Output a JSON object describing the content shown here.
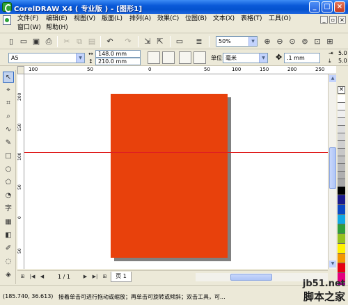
{
  "window": {
    "title": "CorelDRAW X4 ( 专业版 ) - [图形1]",
    "minimize": "_",
    "maximize": "□",
    "close": "×"
  },
  "menu": {
    "row1": [
      "文件(F)",
      "编辑(E)",
      "视图(V)",
      "版面(L)",
      "排列(A)",
      "效果(C)",
      "位图(B)",
      "文本(X)",
      "表格(T)",
      "工具(O)"
    ],
    "row2": [
      "窗口(W)",
      "帮助(H)"
    ]
  },
  "standard_toolbar": {
    "zoom_value": "50%"
  },
  "property_bar": {
    "paper_size": "A5",
    "width": "148.0 mm",
    "height": "210.0 mm",
    "units_label": "单位:",
    "units_value": "毫米",
    "nudge_value": ".1 mm",
    "dup_x": "5.0",
    "dup_y": "5.0"
  },
  "ruler": {
    "top_labels": [
      "100",
      "50",
      "0",
      "50",
      "100",
      "150",
      "200",
      "250"
    ],
    "left_labels": [
      "200",
      "150",
      "100",
      "50",
      "0",
      "50"
    ]
  },
  "page_nav": {
    "first": "|◀",
    "prev": "◀",
    "counter": "1 / 1",
    "next": "▶",
    "last": "▶|",
    "tab": "页 1"
  },
  "status": {
    "coordinates": "(185.740, 36.613)",
    "hint": "接着单击可进行拖动或缩放；再单击可旋转或倾斜；双击工具，可..."
  },
  "watermark": {
    "line1": "jb51.net",
    "line2": "脚本之家"
  },
  "colors": {
    "page_fill": "#e8410c",
    "guide_line": "#e02020",
    "palette": [
      "#000000",
      "#1a1a8c",
      "#0b49c4",
      "#11a7e3",
      "#2f9d3a",
      "#95c11f",
      "#fff100",
      "#f39800",
      "#e60012",
      "#e4007f",
      "#920783",
      "#ffffff"
    ]
  }
}
